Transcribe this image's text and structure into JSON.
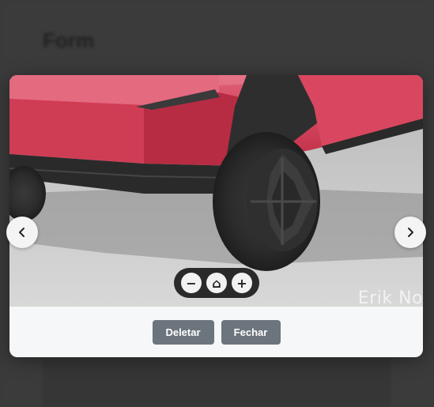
{
  "background_page": {
    "title": "Form"
  },
  "viewer": {
    "watermark": "Erik No",
    "zoom": {
      "zoom_out": "−",
      "reset": "⌂",
      "zoom_in": "+"
    }
  },
  "footer": {
    "delete_label": "Deletar",
    "close_label": "Fechar"
  },
  "nav": {
    "prev_icon": "chevron-left-icon",
    "next_icon": "chevron-right-icon"
  },
  "colors": {
    "car_red": "#d2384e",
    "button_gray": "#6c757d",
    "overlay": "#3a3a3a"
  }
}
